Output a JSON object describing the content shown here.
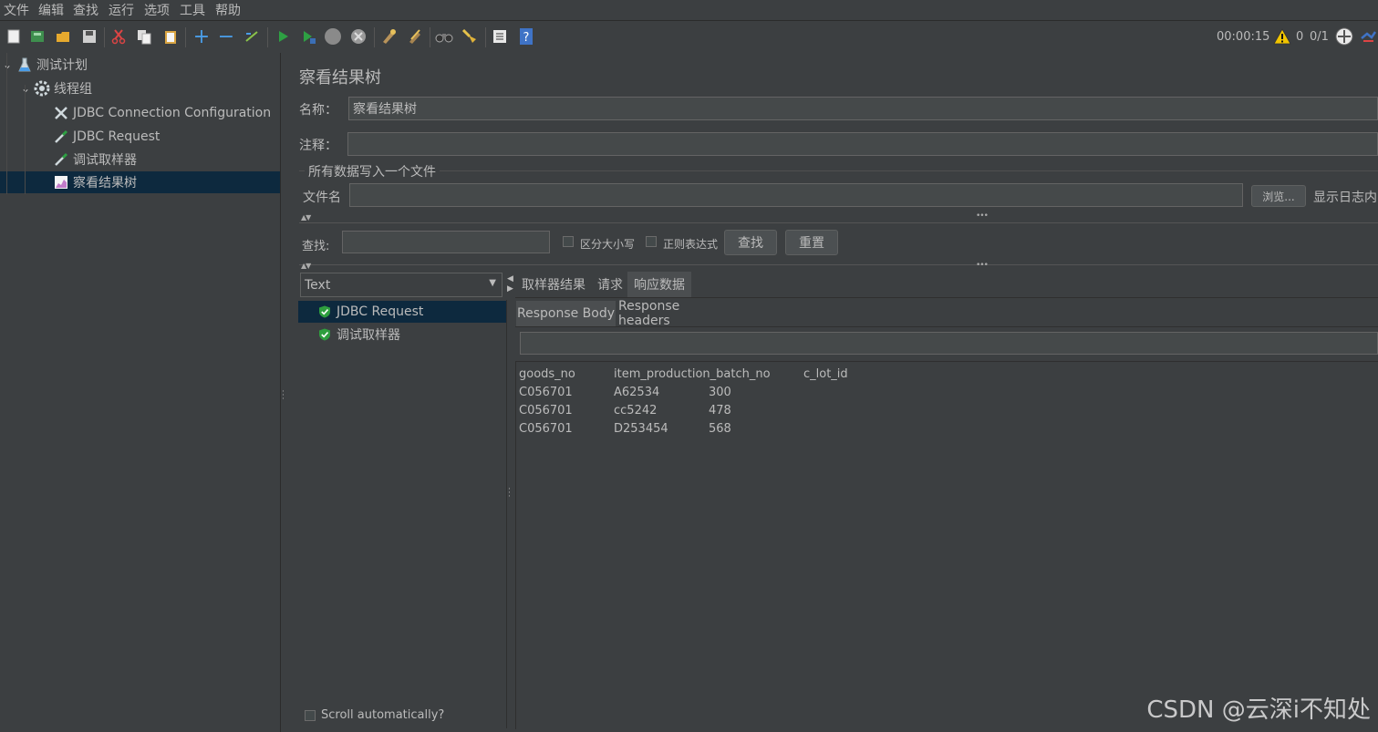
{
  "menu": [
    "文件",
    "编辑",
    "查找",
    "运行",
    "选项",
    "工具",
    "帮助"
  ],
  "status": {
    "elapsed": "00:00:15",
    "warnings": "0",
    "threads": "0/1"
  },
  "tree": {
    "root": "测试计划",
    "group": "线程组",
    "items": [
      "JDBC Connection Configuration",
      "JDBC Request",
      "调试取样器",
      "察看结果树"
    ]
  },
  "panel": {
    "title": "察看结果树",
    "name_label": "名称：",
    "name_value": "察看结果树",
    "comment_label": "注释：",
    "comment_value": "",
    "file_section": "所有数据写入一个文件",
    "filename_label": "文件名",
    "filename_value": "",
    "browse_label": "浏览...",
    "log_label": "显示日志内"
  },
  "search": {
    "label": "查找:",
    "value": "",
    "case_label": "区分大小写",
    "regex_label": "正则表达式",
    "find_button": "查找",
    "reset_button": "重置"
  },
  "renderer": {
    "selected": "Text"
  },
  "results": {
    "items": [
      "JDBC Request",
      "调试取样器"
    ],
    "scroll_label": "Scroll automatically?"
  },
  "tabs": [
    "取样器结果",
    "请求",
    "响应数据"
  ],
  "subtabs": [
    "Response Body",
    "Response headers"
  ],
  "response": {
    "headers": [
      "goods_no",
      "item_production_batch_no",
      "c_lot_id"
    ],
    "rows": [
      [
        "C056701",
        "A62534",
        "300"
      ],
      [
        "C056701",
        "cc5242",
        "478"
      ],
      [
        "C056701",
        "D253454",
        "568"
      ]
    ]
  },
  "watermark": "CSDN @云深i不知处",
  "colors": {
    "background": "#3c3f41",
    "selection": "#0d293e",
    "field": "#45494a",
    "text": "#bbbbbb",
    "success": "#2e9e3e"
  }
}
